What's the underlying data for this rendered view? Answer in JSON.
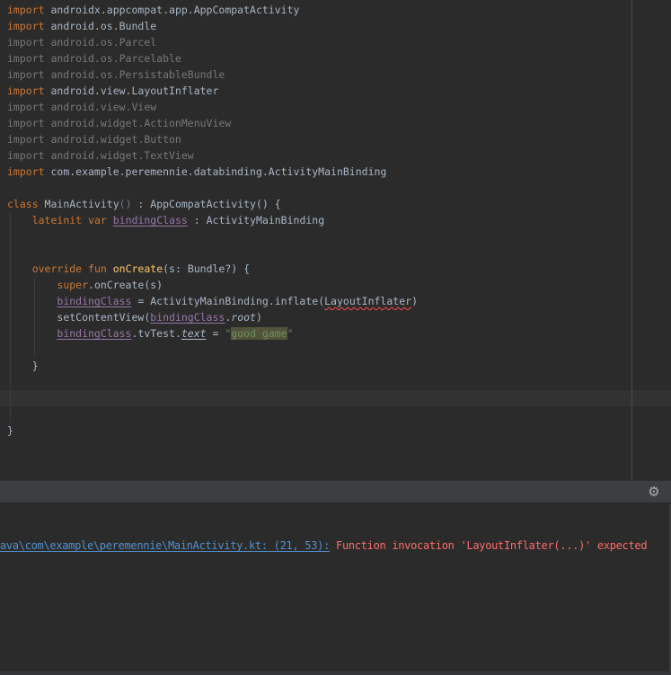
{
  "colors": {
    "editor_background": "#2b2b2b",
    "caret_line_background": "#323232",
    "keyword_orange": "#cc7832",
    "default_text": "#a9b7c6",
    "unused_import_gray": "#787878",
    "field_purple": "#9876aa",
    "function_yellow": "#ffc66b",
    "string_green": "#6a8759",
    "string_highlight_background": "#51533a",
    "error_red": "#ff6b68",
    "link_blue": "#5390cd",
    "toolbar_background": "#3c3f41",
    "right_margin_line": "#4d4d4d"
  },
  "editor": {
    "caret_line_index": 24,
    "lines": [
      [
        {
          "t": "import",
          "s": "kw"
        },
        {
          "t": " androidx.appcompat.app.AppCompatActivity",
          "s": "txt"
        }
      ],
      [
        {
          "t": "import",
          "s": "kw"
        },
        {
          "t": " android.os.Bundle",
          "s": "txt"
        }
      ],
      [
        {
          "t": "import android.os.Parcel",
          "s": "gray"
        }
      ],
      [
        {
          "t": "import android.os.Parcelable",
          "s": "gray"
        }
      ],
      [
        {
          "t": "import android.os.PersistableBundle",
          "s": "gray"
        }
      ],
      [
        {
          "t": "import",
          "s": "kw"
        },
        {
          "t": " android.view.LayoutInflater",
          "s": "txt"
        }
      ],
      [
        {
          "t": "import android.view.View",
          "s": "gray"
        }
      ],
      [
        {
          "t": "import android.widget.ActionMenuView",
          "s": "gray"
        }
      ],
      [
        {
          "t": "import android.widget.Button",
          "s": "gray"
        }
      ],
      [
        {
          "t": "import android.widget.TextView",
          "s": "gray"
        }
      ],
      [
        {
          "t": "import",
          "s": "kw"
        },
        {
          "t": " com.example.peremennie.databinding.ActivityMainBinding",
          "s": "txt"
        }
      ],
      [],
      [
        {
          "t": "class",
          "s": "kw"
        },
        {
          "t": " MainActivity",
          "s": "txt"
        },
        {
          "t": "()",
          "s": "gray"
        },
        {
          "t": " : AppCompatActivity() {",
          "s": "txt"
        }
      ],
      [
        {
          "t": "    ",
          "s": "txt"
        },
        {
          "t": "lateinit var",
          "s": "kw"
        },
        {
          "t": " ",
          "s": "txt"
        },
        {
          "t": "bindingClass",
          "s": "fieldU"
        },
        {
          "t": " : ActivityMainBinding",
          "s": "txt"
        }
      ],
      [],
      [],
      [
        {
          "t": "    ",
          "s": "txt"
        },
        {
          "t": "override fun",
          "s": "kw"
        },
        {
          "t": " ",
          "s": "txt"
        },
        {
          "t": "onCreate",
          "s": "fn"
        },
        {
          "t": "(s: Bundle?) {",
          "s": "txt"
        }
      ],
      [
        {
          "t": "        ",
          "s": "txt"
        },
        {
          "t": "super",
          "s": "kw"
        },
        {
          "t": ".onCreate(s)",
          "s": "txt"
        }
      ],
      [
        {
          "t": "        ",
          "s": "txt"
        },
        {
          "t": "bindingClass",
          "s": "fieldU"
        },
        {
          "t": " = ActivityMainBinding.inflate(",
          "s": "txt"
        },
        {
          "t": "LayoutInflater",
          "s": "errSq"
        },
        {
          "t": ")",
          "s": "txt"
        }
      ],
      [
        {
          "t": "        ",
          "s": "txt"
        },
        {
          "t": "setContentView(",
          "s": "txt"
        },
        {
          "t": "bindingClass",
          "s": "fieldU"
        },
        {
          "t": ".",
          "s": "txt"
        },
        {
          "t": "root",
          "s": "propI"
        },
        {
          "t": ")",
          "s": "txt"
        }
      ],
      [
        {
          "t": "        ",
          "s": "txt"
        },
        {
          "t": "bindingClass",
          "s": "fieldU"
        },
        {
          "t": ".tvTest.",
          "s": "txt"
        },
        {
          "t": "text",
          "s": "propIU"
        },
        {
          "t": " = ",
          "s": "txt"
        },
        {
          "t": "\"",
          "s": "str"
        },
        {
          "t": "good game",
          "s": "strHl"
        },
        {
          "t": "\"",
          "s": "str"
        }
      ],
      [],
      [
        {
          "t": "    }",
          "s": "txt"
        }
      ],
      [],
      [],
      [],
      [
        {
          "t": "}",
          "s": "txt"
        }
      ],
      [],
      []
    ]
  },
  "toolbar": {
    "settings_icon_glyph": "⚙"
  },
  "console": {
    "link_text": "ava\\com\\example\\peremennie\\MainActivity.kt: (21, 53):",
    "error_text": "Function invocation 'LayoutInflater(...)' expected"
  }
}
